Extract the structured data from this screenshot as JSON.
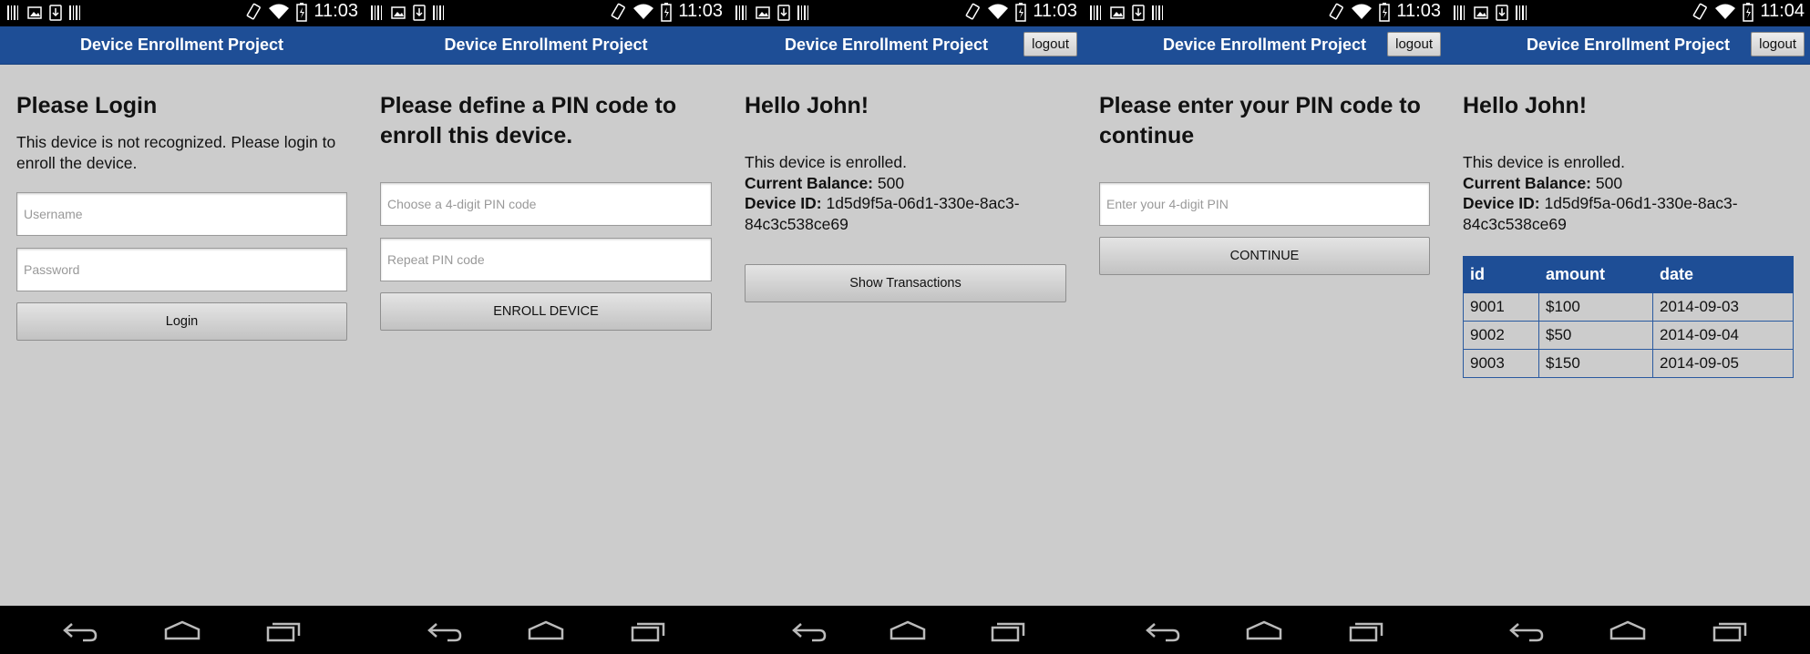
{
  "status": {
    "times": [
      "11:03",
      "11:03",
      "11:03",
      "11:03",
      "11:04"
    ]
  },
  "app_title": "Device Enrollment Project",
  "logout_label": "logout",
  "screen1": {
    "heading": "Please Login",
    "message": "This device is not recognized. Please login to enroll the device.",
    "username_placeholder": "Username",
    "password_placeholder": "Password",
    "login_label": "Login"
  },
  "screen2": {
    "heading": "Please define a PIN code to enroll this device.",
    "pin_placeholder": "Choose a 4-digit PIN code",
    "repeat_placeholder": "Repeat PIN code",
    "enroll_label": "ENROLL DEVICE"
  },
  "screen3": {
    "heading": "Hello John!",
    "enrolled_text": "This device is enrolled.",
    "balance_label": "Current Balance:",
    "balance_value": "500",
    "device_id_label": "Device ID:",
    "device_id_value": "1d5d9f5a-06d1-330e-8ac3-84c3c538ce69",
    "show_tx_label": "Show Transactions"
  },
  "screen4": {
    "heading": "Please enter your PIN code to continue",
    "pin_placeholder": "Enter your 4-digit PIN",
    "continue_label": "CONTINUE"
  },
  "screen5": {
    "heading": "Hello John!",
    "enrolled_text": "This device is enrolled.",
    "balance_label": "Current Balance:",
    "balance_value": "500",
    "device_id_label": "Device ID:",
    "device_id_value": "1d5d9f5a-06d1-330e-8ac3-84c3c538ce69",
    "table": {
      "headers": [
        "id",
        "amount",
        "date"
      ],
      "rows": [
        [
          "9001",
          "$100",
          "2014-09-03"
        ],
        [
          "9002",
          "$50",
          "2014-09-04"
        ],
        [
          "9003",
          "$150",
          "2014-09-05"
        ]
      ]
    }
  },
  "icons": {
    "status_left": [
      "barcode-icon",
      "image-icon",
      "download-icon",
      "barcode-icon"
    ],
    "status_right": [
      "vibrate-icon",
      "wifi-icon",
      "battery-charging-icon"
    ],
    "nav": [
      "back-icon",
      "home-icon",
      "recent-apps-icon"
    ]
  },
  "colors": {
    "action_bar": "#1e4e96",
    "background": "#cccccc",
    "status_bar": "#000000"
  }
}
